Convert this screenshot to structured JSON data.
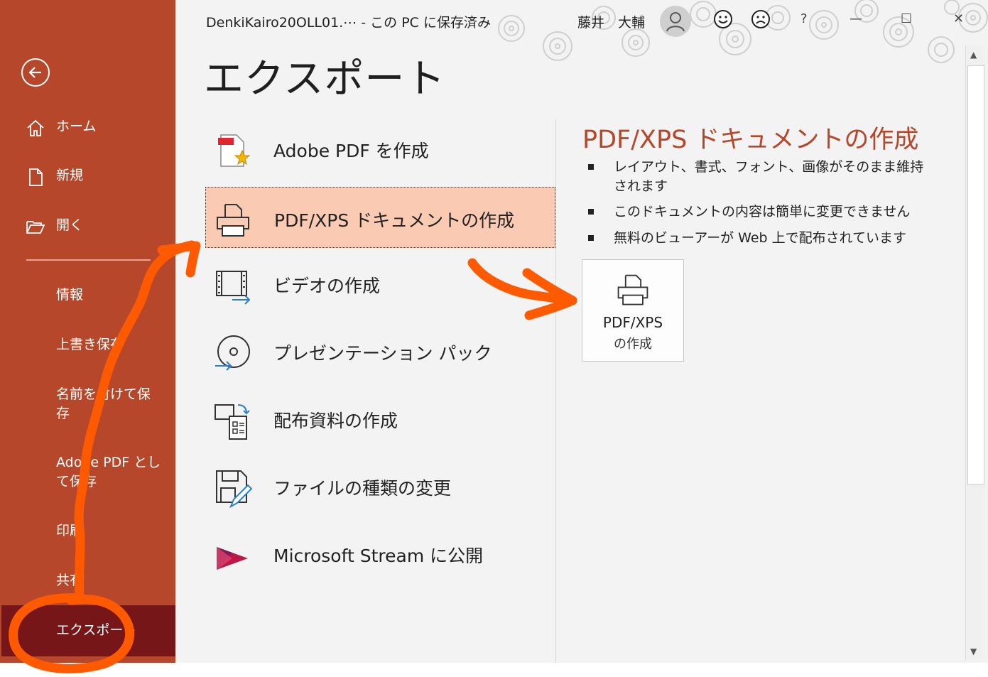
{
  "titlebar": {
    "file_name": "DenkiKairo20OLL01.⋯  -  この PC に保存済み",
    "user_name": "藤井　大輔",
    "help": "?",
    "minimize": "—",
    "maximize": "☐",
    "close": "✕"
  },
  "sidebar": {
    "home": "ホーム",
    "new": "新規",
    "open": "開く",
    "info": "情報",
    "save": "上書き保存",
    "save_as": "名前を付けて保存",
    "save_adobe": "Adobe PDF として保存",
    "print": "印刷",
    "share": "共有",
    "export": "エクスポート"
  },
  "main": {
    "title": "エクスポート",
    "items": [
      {
        "label": "Adobe PDF を作成",
        "icon": "adobe-pdf-icon"
      },
      {
        "label": "PDF/XPS ドキュメントの作成",
        "icon": "printer-icon"
      },
      {
        "label": "ビデオの作成",
        "icon": "video-icon"
      },
      {
        "label": "プレゼンテーション パック",
        "icon": "disc-icon"
      },
      {
        "label": "配布資料の作成",
        "icon": "handout-icon"
      },
      {
        "label": "ファイルの種類の変更",
        "icon": "save-as-icon"
      },
      {
        "label": "Microsoft Stream に公開",
        "icon": "stream-icon"
      }
    ]
  },
  "detail": {
    "title": "PDF/XPS ドキュメントの作成",
    "bullets": [
      "レイアウト、書式、フォント、画像がそのまま維持されます",
      "このドキュメントの内容は簡単に変更できません",
      "無料のビューアーが Web 上で配布されています"
    ],
    "button_line1": "PDF/XPS",
    "button_line2": "の作成"
  },
  "colors": {
    "sidebar": "#b7472a",
    "sidebar_selected": "#761618",
    "accent": "#b7472a",
    "selected_item": "#fbcab3",
    "annotation": "#ff5a00"
  }
}
